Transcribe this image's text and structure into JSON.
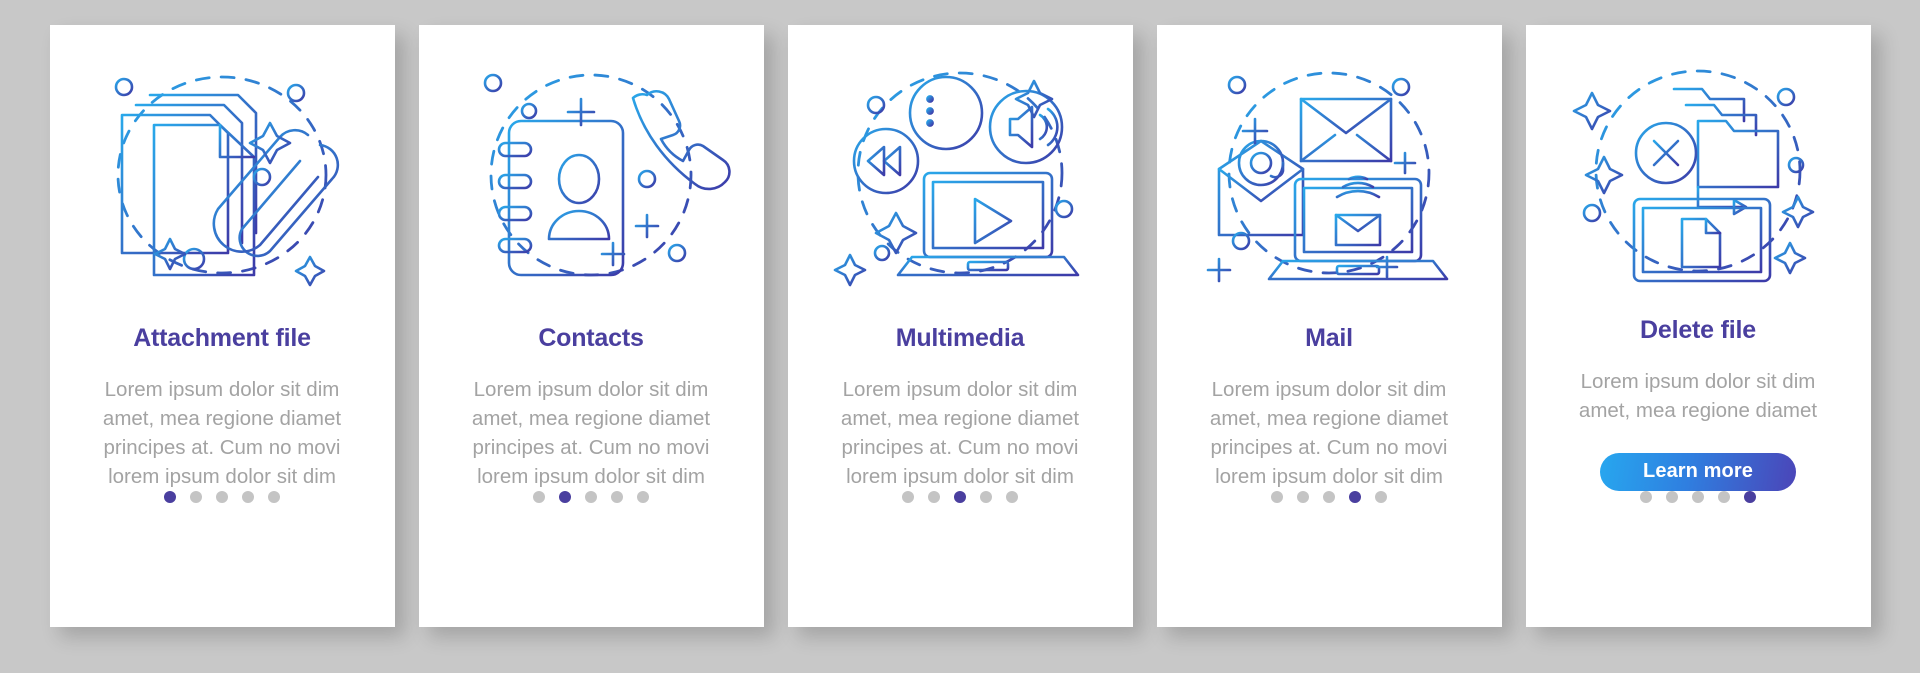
{
  "page": {
    "background_color": "#c8c8c8",
    "card_background": "#ffffff",
    "title_color": "#4a3f9f",
    "body_color": "#a3a3a3",
    "dot_active_color": "#4a3f9f",
    "dot_inactive_color": "#c4c4c4",
    "illustration_gradient_from": "#29a8ea",
    "illustration_gradient_to": "#3d3aa8"
  },
  "cards": [
    {
      "id": "attachment-file",
      "title": "Attachment file",
      "body": "Lorem ipsum dolor sit dim amet, mea regione diamet principes at. Cum no movi lorem ipsum dolor sit dim",
      "icon": "attachment-documents-paperclip-icon",
      "dots": {
        "total": 5,
        "active_index": 0
      },
      "button": null
    },
    {
      "id": "contacts",
      "title": "Contacts",
      "body": "Lorem ipsum dolor sit dim amet, mea regione diamet principes at. Cum no movi lorem ipsum dolor sit dim",
      "icon": "contacts-addressbook-phone-icon",
      "dots": {
        "total": 5,
        "active_index": 1
      },
      "button": null
    },
    {
      "id": "multimedia",
      "title": "Multimedia",
      "body": "Lorem ipsum dolor sit dim amet, mea regione diamet principes at. Cum no movi lorem ipsum dolor sit dim",
      "icon": "multimedia-laptop-play-icon",
      "dots": {
        "total": 5,
        "active_index": 2
      },
      "button": null
    },
    {
      "id": "mail",
      "title": "Mail",
      "body": "Lorem ipsum dolor sit dim amet, mea regione diamet principes at. Cum no movi lorem ipsum dolor sit dim",
      "icon": "mail-envelope-laptop-icon",
      "dots": {
        "total": 5,
        "active_index": 3
      },
      "button": null
    },
    {
      "id": "delete-file",
      "title": "Delete file",
      "body": "Lorem ipsum dolor sit dim amet, mea regione diamet",
      "icon": "delete-file-folder-laptop-icon",
      "dots": {
        "total": 5,
        "active_index": 4
      },
      "button": {
        "label": "Learn more"
      }
    }
  ]
}
